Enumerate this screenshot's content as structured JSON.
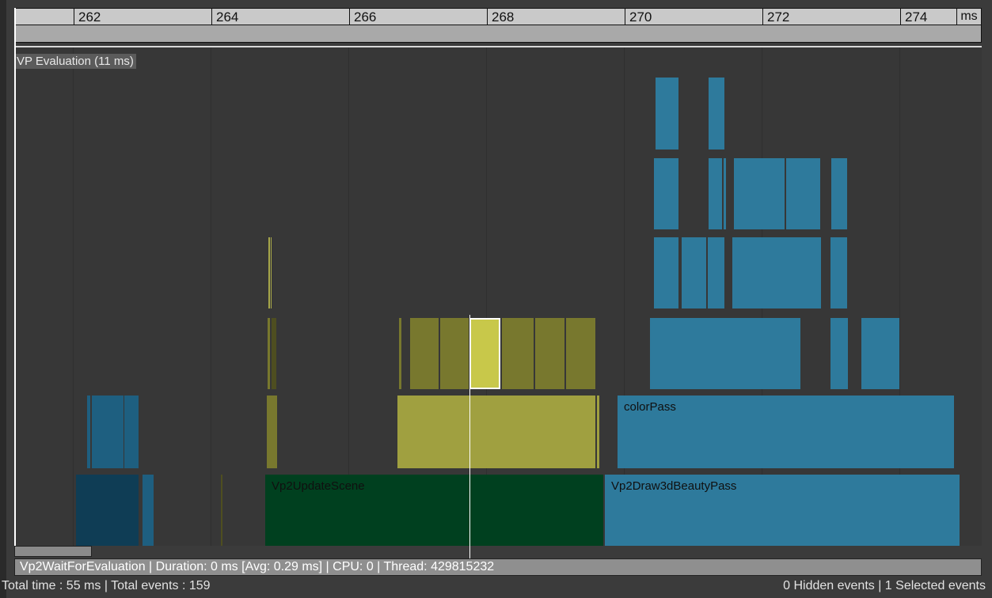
{
  "ruler": {
    "ticks": [
      "262",
      "264",
      "266",
      "268",
      "270",
      "272",
      "274"
    ],
    "unit": "ms"
  },
  "track": {
    "title": "VP Evaluation (11 ms)"
  },
  "events": {
    "vp2_update_scene": "Vp2UpdateScene",
    "vp2_draw3d_beauty_pass": "Vp2Draw3dBeautyPass",
    "color_pass": "colorPass"
  },
  "status": {
    "selected_event": "Vp2WaitForEvaluation | Duration: 0 ms [Avg: 0.29 ms] | CPU: 0 | Thread: 429815232"
  },
  "footer": {
    "left": "Total time : 55 ms | Total events : 159",
    "right": "0 Hidden events | 1 Selected events"
  },
  "colors": {
    "blue": "#2e7a9c",
    "dark_blue": "#0f3d55",
    "olive": "#78782e",
    "olive_light": "#a8a84a",
    "selected": "#c8c84a",
    "green": "#00401f"
  }
}
